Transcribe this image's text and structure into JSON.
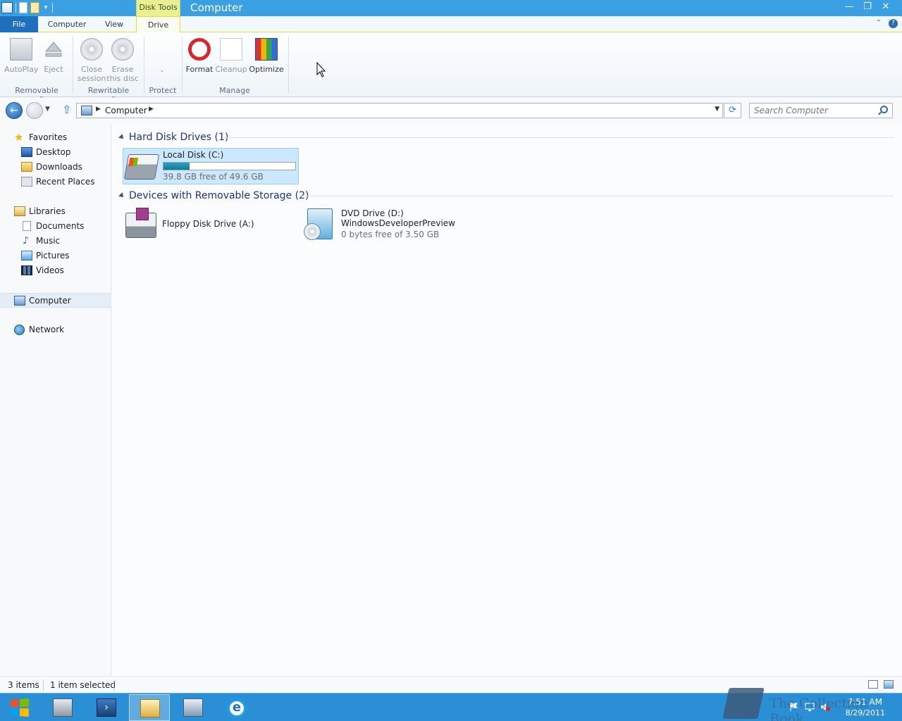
{
  "titlebar": {
    "context_tab": "Disk Tools",
    "title": "Computer",
    "buttons": {
      "minimize": "—",
      "restore": "❐",
      "close": "✕"
    }
  },
  "ribbon_tabs": {
    "file": "File",
    "computer": "Computer",
    "view": "View",
    "drive": "Drive",
    "help": "?"
  },
  "ribbon": {
    "autoplay": "AutoPlay",
    "eject": "Eject",
    "removable_media": "Removable media",
    "close_session_1": "Close",
    "close_session_2": "session",
    "erase_disc_1": "Erase",
    "erase_disc_2": "this disc",
    "rewritable_media": "Rewritable media",
    "protect": "Protect",
    "format": "Format",
    "cleanup": "Cleanup",
    "optimize": "Optimize",
    "manage": "Manage"
  },
  "address": {
    "crumb": "Computer",
    "search_placeholder": "Search Computer"
  },
  "nav": {
    "favorites": "Favorites",
    "desktop": "Desktop",
    "downloads": "Downloads",
    "recent_places": "Recent Places",
    "libraries": "Libraries",
    "documents": "Documents",
    "music": "Music",
    "pictures": "Pictures",
    "videos": "Videos",
    "computer": "Computer",
    "network": "Network"
  },
  "content": {
    "hdd_group": "Hard Disk Drives (1)",
    "removable_group": "Devices with Removable Storage (2)",
    "local_disk": {
      "name": "Local Disk (C:)",
      "free": "39.8 GB free of 49.6 GB",
      "used_fraction": 0.2
    },
    "floppy": {
      "name": "Floppy Disk Drive (A:)"
    },
    "dvd": {
      "name": "DVD Drive (D:)",
      "label": "WindowsDeveloperPreview",
      "free": "0 bytes free of 3.50 GB"
    }
  },
  "status": {
    "items": "3 items",
    "selected": "1 item selected"
  },
  "taskbar": {
    "time": "7:51 AM",
    "date": "8/29/2011"
  },
  "watermark": "The Collection Book",
  "colors": {
    "titlebar": "#3aa0e3",
    "taskbar": "#2b8fd6",
    "context_tab": "#e9f093",
    "selection": "#cce8ff",
    "usage_bar": "#1b8bb0",
    "group_title": "#1e3287"
  }
}
